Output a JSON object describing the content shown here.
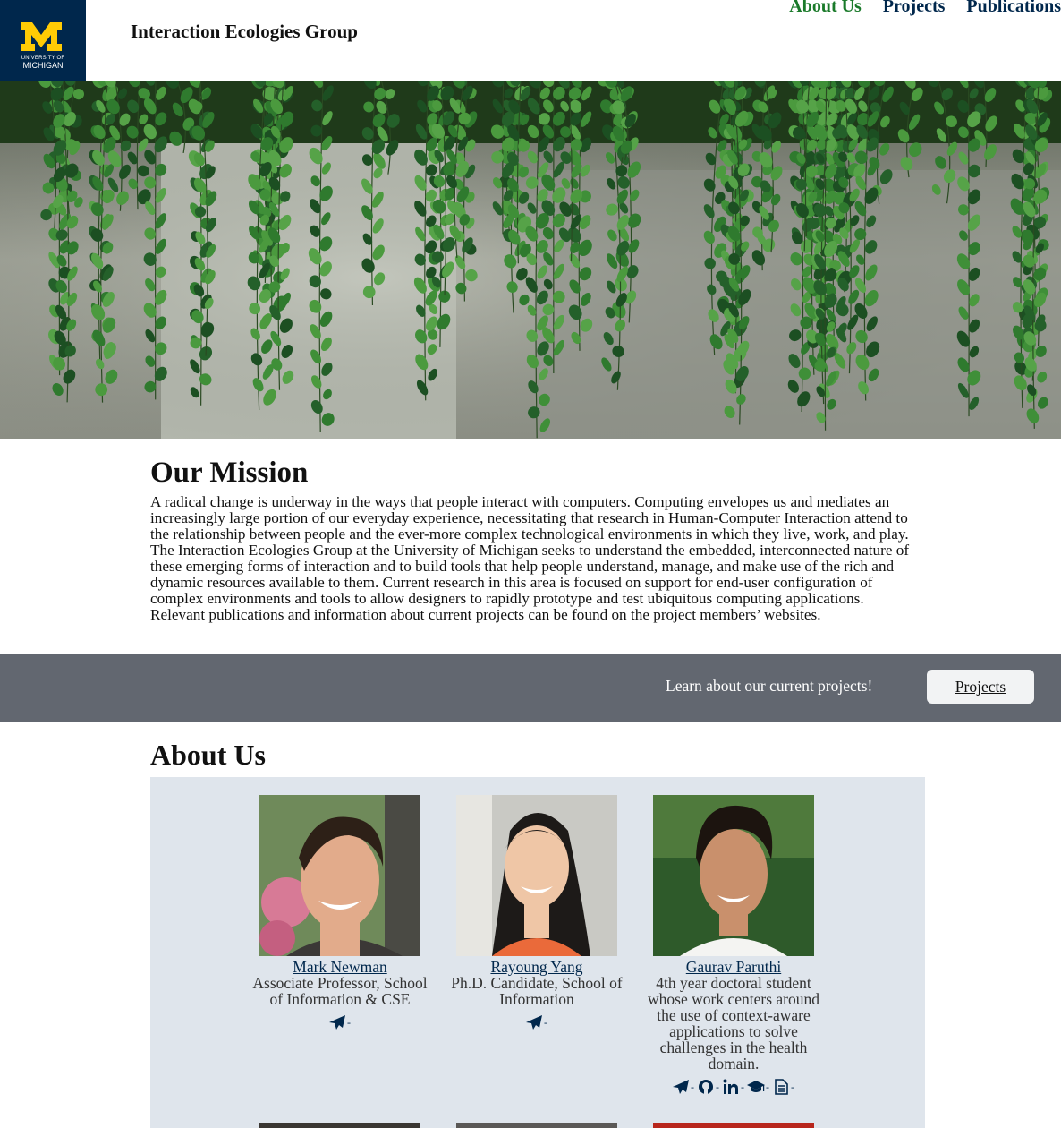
{
  "header": {
    "logo": {
      "university_text": "UNIVERSITY OF",
      "michigan_text": "MICHIGAN",
      "colors": {
        "blue": "#00274c",
        "maize": "#ffcb05"
      }
    },
    "site_title": "Interaction Ecologies Group",
    "nav": [
      {
        "label": "About Us",
        "active": true
      },
      {
        "label": "Projects",
        "active": false
      },
      {
        "label": "Publications",
        "active": false
      }
    ]
  },
  "hero": {
    "description_icon": "ivy-on-concrete-photo"
  },
  "mission": {
    "heading": "Our Mission",
    "body": "A radical change is underway in the ways that people interact with computers. Computing envelopes us and mediates an increasingly large portion of our everyday experience, necessitating that research in Human-Computer Interaction attend to the relationship between people and the ever-more complex technological environments in which they live, work, and play. The Interaction Ecologies Group at the University of Michigan seeks to understand the embedded, interconnected nature of these emerging forms of interaction and to build tools that help people understand, manage, and make use of the rich and dynamic resources available to them. Current research in this area is focused on support for end-user configuration of complex environments and tools to allow designers to rapidly prototype and test ubiquitous computing applications. Relevant publications and information about current projects can be found on the project members’ websites."
  },
  "cta": {
    "text": "Learn about our current projects!",
    "button_label": "Projects"
  },
  "about": {
    "heading": "About Us",
    "people": [
      {
        "name": "Mark Newman",
        "role": "Associate Professor, School of Information & CSE",
        "links": [
          "paper-plane-icon"
        ]
      },
      {
        "name": "Rayoung Yang",
        "role": "Ph.D. Candidate, School of Information",
        "links": [
          "paper-plane-icon"
        ]
      },
      {
        "name": "Gaurav Paruthi",
        "role": "4th year doctoral student whose work centers around the use of context-aware applications to solve challenges in the health domain.",
        "links": [
          "paper-plane-icon",
          "github-icon",
          "linkedin-icon",
          "graduation-cap-icon",
          "document-icon"
        ]
      }
    ]
  }
}
